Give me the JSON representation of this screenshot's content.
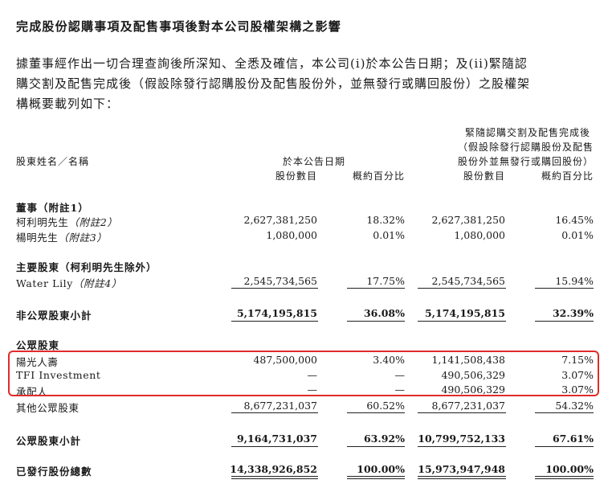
{
  "title": "完成股份認購事項及配售事項後對本公司股權架構之影響",
  "paragraph": [
    "據董事經作出一切合理查詢後所深知、全悉及確信，本公司(i)於本公告日期；及(ii)緊隨認",
    "購交割及配售完成後（假設除發行認購股份及配售股份外，並無發行或購回股份）之股權架",
    "構概要載列如下："
  ],
  "headers": {
    "shareholder": "股東姓名／名稱",
    "col_group_1": "於本公告日期",
    "col_group_2_lines": [
      "緊隨認購交割及配售完成後",
      "（假設除發行認購股份及配售",
      "股份外並無發行或購回股份）"
    ],
    "shares": "股份數目",
    "percent": "概約百分比"
  },
  "sections": {
    "directors": "董事（附註1）",
    "substantial": "主要股東（柯利明先生除外）",
    "nonpublic_subtotal": "非公眾股東小計",
    "public": "公眾股東",
    "public_subtotal": "公眾股東小計",
    "total": "已發行股份總數"
  },
  "rows": {
    "ke": {
      "name": "柯利明先生",
      "note": "（附註2）",
      "s1": "2,627,381,250",
      "p1": "18.32%",
      "s2": "2,627,381,250",
      "p2": "16.45%"
    },
    "yang": {
      "name": "楊明先生",
      "note": "（附註3）",
      "s1": "1,080,000",
      "p1": "0.01%",
      "s2": "1,080,000",
      "p2": "0.01%"
    },
    "water": {
      "name": "Water Lily",
      "note": "（附註4）",
      "s1": "2,545,734,565",
      "p1": "17.75%",
      "s2": "2,545,734,565",
      "p2": "15.94%"
    },
    "nonpublic": {
      "s1": "5,174,195,815",
      "p1": "36.08%",
      "s2": "5,174,195,815",
      "p2": "32.39%"
    },
    "sunshine": {
      "name": "陽光人壽",
      "s1": "487,500,000",
      "p1": "3.40%",
      "s2": "1,141,508,438",
      "p2": "7.15%"
    },
    "tfi": {
      "name": "TFI Investment",
      "s1": "—",
      "p1": "—",
      "s2": "490,506,329",
      "p2": "3.07%"
    },
    "placees": {
      "name": "承配人",
      "s1": "—",
      "p1": "—",
      "s2": "490,506,329",
      "p2": "3.07%"
    },
    "others": {
      "name": "其他公眾股東",
      "s1": "8,677,231,037",
      "p1": "60.52%",
      "s2": "8,677,231,037",
      "p2": "54.32%"
    },
    "public_sub": {
      "s1": "9,164,731,037",
      "p1": "63.92%",
      "s2": "10,799,752,133",
      "p2": "67.61%"
    },
    "total": {
      "s1": "14,338,926,852",
      "p1": "100.00%",
      "s2": "15,973,947,948",
      "p2": "100.00%"
    }
  }
}
